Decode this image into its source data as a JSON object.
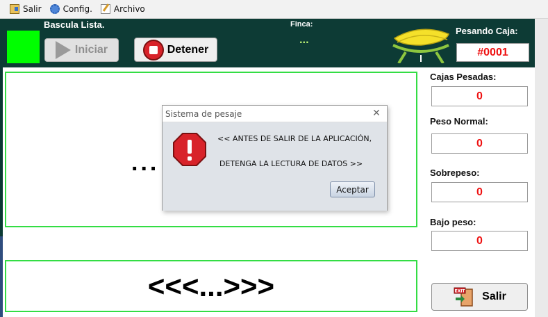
{
  "menubar": {
    "items": [
      {
        "label": "Salir",
        "icon": "exit-icon"
      },
      {
        "label": "Config.",
        "icon": "gear-icon"
      },
      {
        "label": "Archivo",
        "icon": "document-edit-icon"
      }
    ]
  },
  "header": {
    "status_label": "Bascula Lista.",
    "status_color": "#00ff00",
    "iniciar_label": "Iniciar",
    "detener_label": "Detener",
    "finca_label": "Finca:",
    "finca_value": "...",
    "pesando_label": "Pesando Caja:",
    "caja_value": "#0001",
    "accent_color": "#ee1111",
    "header_color": "#0d3b35"
  },
  "main": {
    "top_panel_text": "...",
    "bottom_panel_text": "<<<...>>>"
  },
  "stats": {
    "cajas_pesadas_label": "Cajas Pesadas:",
    "cajas_pesadas_value": "0",
    "peso_normal_label": "Peso Normal:",
    "peso_normal_value": "0",
    "sobrepeso_label": "Sobrepeso:",
    "sobrepeso_value": "0",
    "bajo_peso_label": "Bajo peso:",
    "bajo_peso_value": "0"
  },
  "salir_button_label": "Salir",
  "dialog": {
    "title": "Sistema de pesaje",
    "message_line1": "<< ANTES DE SALIR DE LA APLICACIÓN,",
    "message_line2": "DETENGA LA LECTURA DE DATOS >>",
    "accept_label": "Aceptar",
    "icon": "error-stop-icon"
  }
}
